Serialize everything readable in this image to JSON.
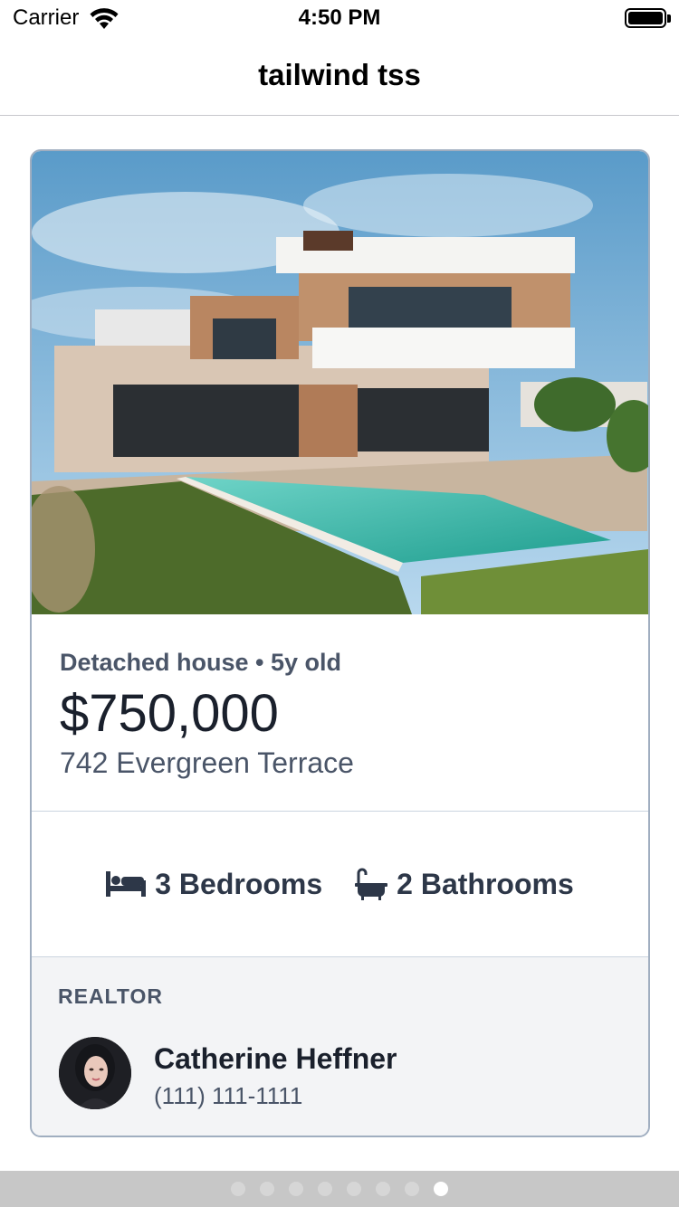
{
  "status_bar": {
    "carrier": "Carrier",
    "time": "4:50 PM",
    "wifi_icon": "wifi-icon",
    "battery_icon": "battery-icon"
  },
  "nav": {
    "title": "tailwind tss"
  },
  "listing": {
    "photo": "house-with-pool-photo",
    "eyebrow": "Detached house • 5y old",
    "price": "$750,000",
    "address": "742 Evergreen Terrace",
    "bedrooms": "3 Bedrooms",
    "bathrooms": "2 Bathrooms",
    "bed_icon": "bed-icon",
    "bath_icon": "bathtub-icon"
  },
  "realtor": {
    "label": "REALTOR",
    "name": "Catherine Heffner",
    "phone": "(111) 111-1111",
    "avatar": "avatar"
  },
  "pager": {
    "page_count": 8,
    "active_page": 8
  },
  "colors": {
    "card_border": "#a0aec0",
    "text_dark": "#1a202c",
    "text_muted": "#4a5568",
    "realtor_bg": "#f3f4f6",
    "pool": "#2bb5a8"
  }
}
